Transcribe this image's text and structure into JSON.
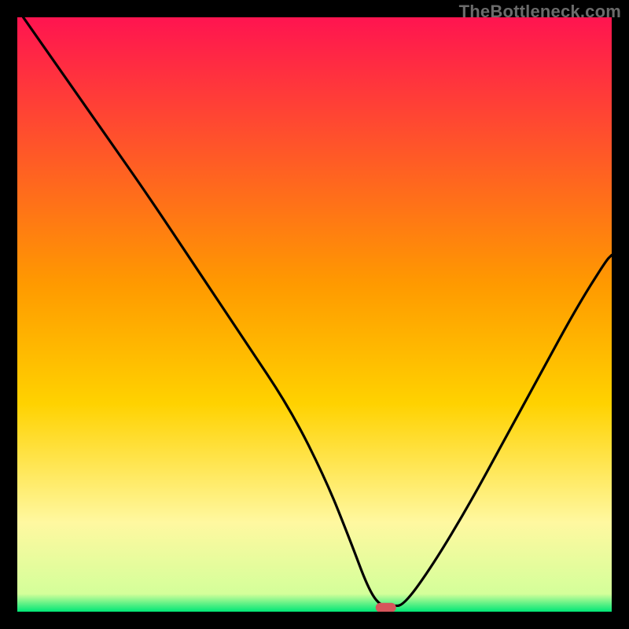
{
  "watermark": "TheBottleneck.com",
  "chart_data": {
    "type": "line",
    "title": "",
    "xlabel": "",
    "ylabel": "",
    "xlim": [
      0,
      100
    ],
    "ylim": [
      0,
      100
    ],
    "grid": false,
    "legend": false,
    "background_gradient": {
      "top_color": "#ff1450",
      "mid_color": "#ffd200",
      "lower_color": "#fff8a0",
      "bottom_color": "#00e676"
    },
    "series": [
      {
        "name": "bottleneck-curve",
        "x": [
          1,
          8,
          15,
          22,
          30,
          38,
          46,
          52,
          56,
          59,
          61,
          63,
          65,
          70,
          76,
          82,
          88,
          94,
          99,
          100
        ],
        "y": [
          100,
          90,
          80,
          70,
          58,
          46,
          34,
          22,
          12,
          4,
          1,
          1,
          1,
          8,
          18,
          29,
          40,
          51,
          59,
          60
        ]
      }
    ],
    "marker": {
      "name": "optimal-point",
      "x": 62,
      "y": 0.7,
      "color": "#d6565b",
      "shape": "pill"
    }
  }
}
